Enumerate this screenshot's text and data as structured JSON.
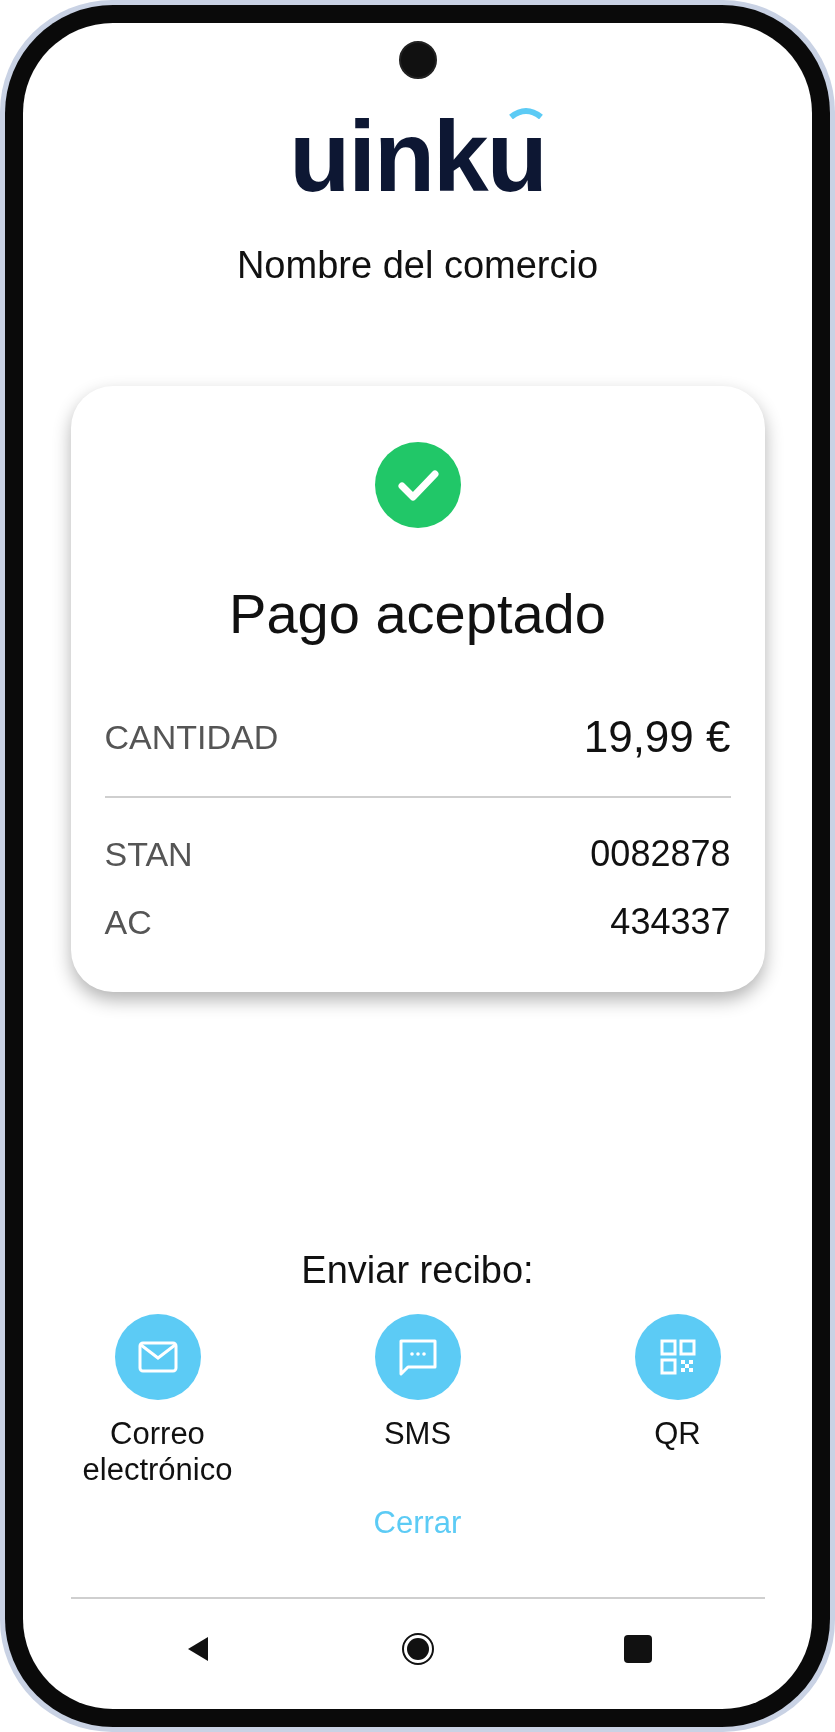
{
  "logo": {
    "text": "uinku"
  },
  "merchant": "Nombre del comercio",
  "result": {
    "accepted": true,
    "title": "Pago aceptado",
    "rows": [
      {
        "kind": "amount",
        "label": "CANTIDAD",
        "value": "19,99 €"
      },
      {
        "kind": "detail",
        "label": "STAN",
        "value": "0082878"
      },
      {
        "kind": "detail",
        "label": "AC",
        "value": "434337"
      }
    ]
  },
  "receipt": {
    "title": "Enviar recibo:",
    "options": [
      {
        "kind": "email",
        "label": "Correo electrónico"
      },
      {
        "kind": "sms",
        "label": "SMS"
      },
      {
        "kind": "qr",
        "label": "QR"
      }
    ]
  },
  "close": "Cerrar",
  "nav": [
    {
      "kind": "back"
    },
    {
      "kind": "home"
    },
    {
      "kind": "recents"
    }
  ]
}
